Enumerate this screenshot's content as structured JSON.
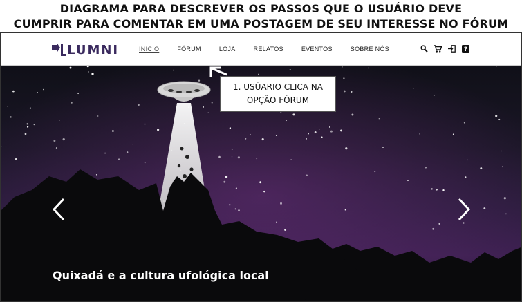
{
  "diagram": {
    "title_line1": "DIAGRAMA PARA DESCREVER OS PASSOS QUE O USUÁRIO DEVE",
    "title_line2": "CUMPRIR PARA COMENTAR EM UMA POSTAGEM DE SEU INTERESSE NO FÓRUM"
  },
  "site": {
    "logo_text": "LUMNI",
    "brand_color": "#3a2a5e"
  },
  "nav": {
    "items": [
      {
        "label": "INÍCIO",
        "active": true
      },
      {
        "label": "FÓRUM",
        "active": false
      },
      {
        "label": "LOJA",
        "active": false
      },
      {
        "label": "RELATOS",
        "active": false
      },
      {
        "label": "EVENTOS",
        "active": false
      },
      {
        "label": "SOBRE NÓS",
        "active": false
      }
    ],
    "icons": [
      "search-icon",
      "cart-icon",
      "login-icon",
      "help-icon"
    ]
  },
  "hero": {
    "caption": "Quixadá e a cultura ufológica local",
    "slide_count": 4,
    "active_slide": 1
  },
  "annotation": {
    "line1": "1. USÚARIO CLICA NA",
    "line2": "OPÇÃO FÓRUM"
  }
}
